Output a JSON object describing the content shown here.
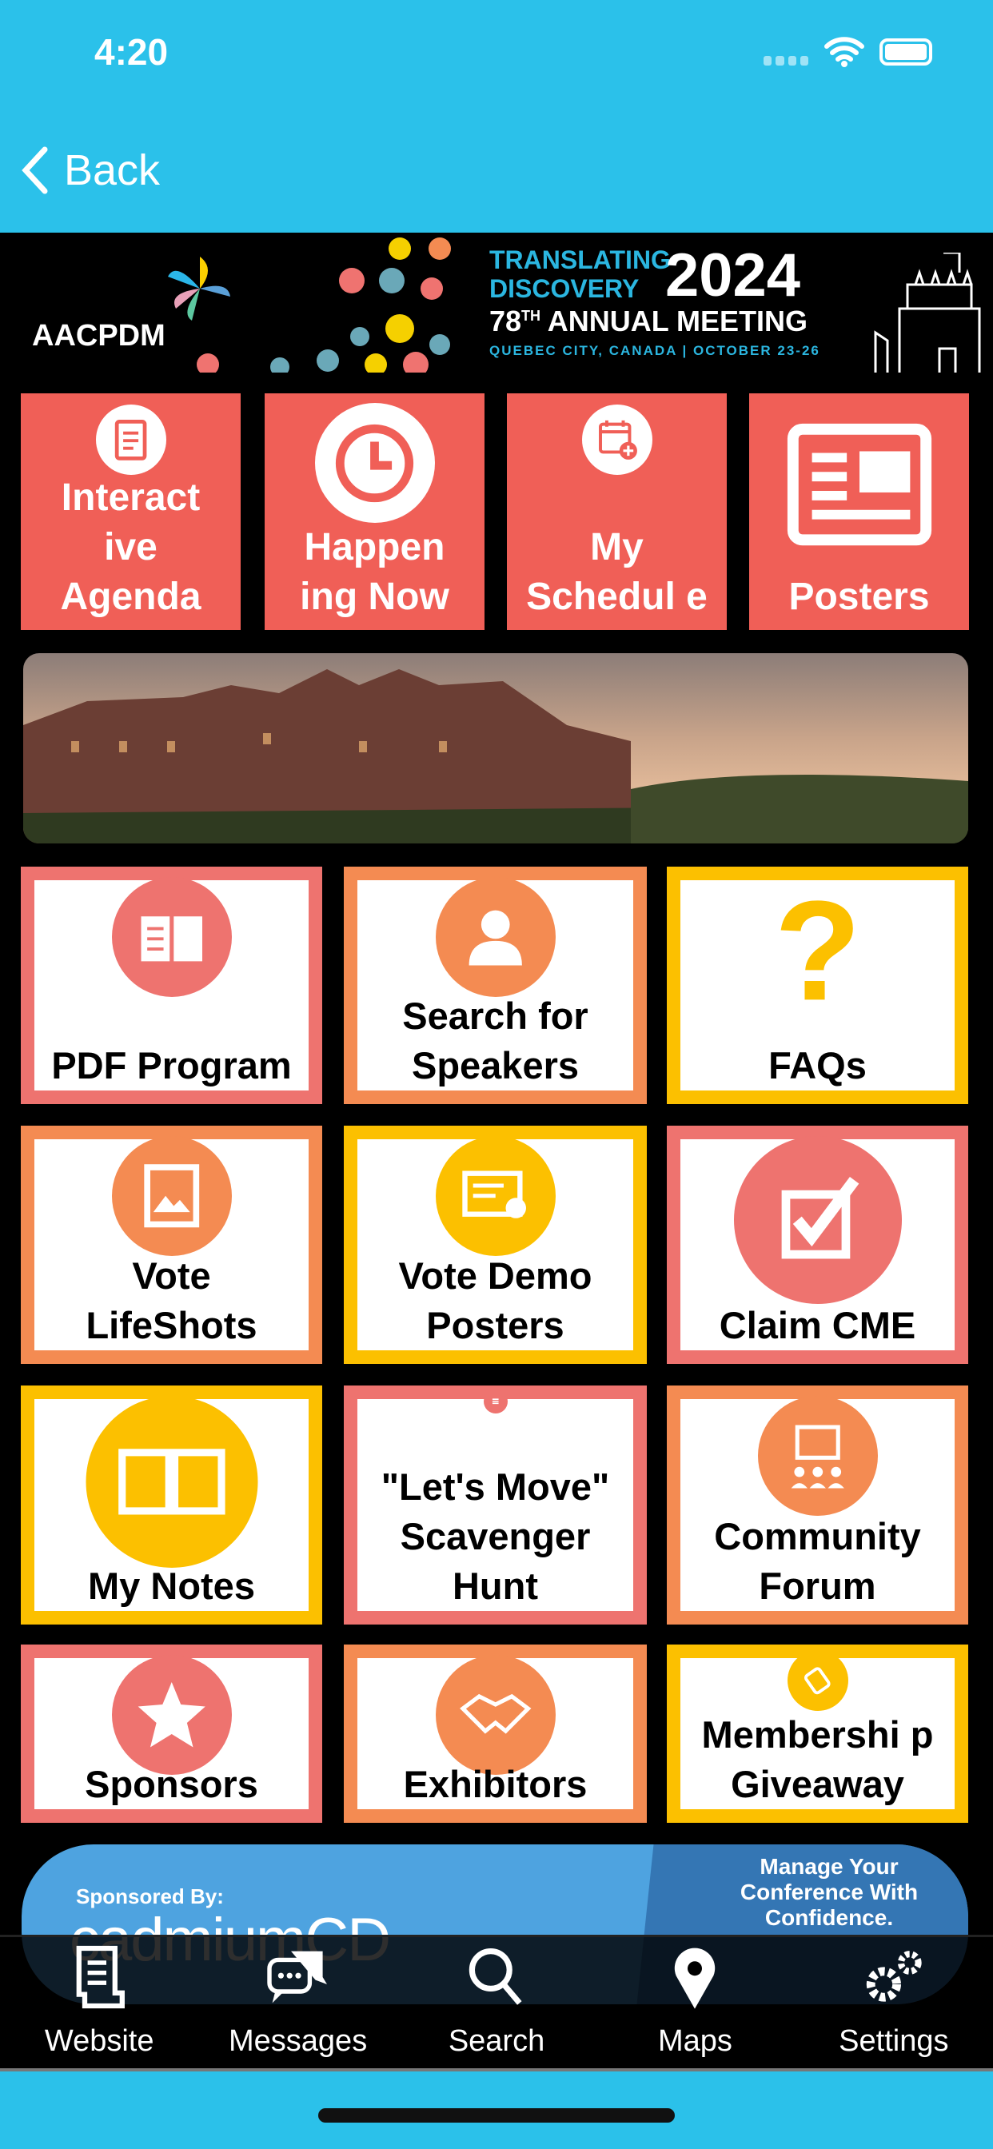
{
  "status": {
    "time": "4:20"
  },
  "nav": {
    "back_label": "Back"
  },
  "banner": {
    "org": "AACPDM",
    "line1": "TRANSLATING",
    "line2": "DISCOVERY",
    "year": "2024",
    "meeting_num": "78",
    "meeting_sup": "TH",
    "meeting": "ANNUAL MEETING",
    "location": "QUEBEC CITY, CANADA",
    "dates": "OCTOBER 23-26"
  },
  "top_tiles": [
    {
      "label": "Interact ive Agenda",
      "icon": "clipboard-icon"
    },
    {
      "label": "Happen ing Now",
      "icon": "clock-icon"
    },
    {
      "label": "My Schedul e",
      "icon": "calendar-add-icon"
    },
    {
      "label": "Posters",
      "icon": "newspaper-icon"
    }
  ],
  "grid": [
    {
      "label": "PDF Program",
      "icon": "book-icon",
      "color": "#ee736f"
    },
    {
      "label": "Search for Speakers",
      "icon": "person-icon",
      "color": "#f48b52"
    },
    {
      "label": "FAQs",
      "icon": "question-icon",
      "color": "#fcc000"
    },
    {
      "label": "Vote LifeShots",
      "icon": "image-icon",
      "color": "#f48b52"
    },
    {
      "label": "Vote Demo Posters",
      "icon": "certificate-icon",
      "color": "#fcc000"
    },
    {
      "label": "Claim CME",
      "icon": "checkbox-icon",
      "color": "#ee736f"
    },
    {
      "label": "My Notes",
      "icon": "open-book-icon",
      "color": "#fcc000"
    },
    {
      "label": "\"Let's Move\" Scavenger Hunt",
      "icon": "list-icon",
      "color": "#ee736f"
    },
    {
      "label": "Community Forum",
      "icon": "presentation-icon",
      "color": "#f48b52"
    },
    {
      "label": "Sponsors",
      "icon": "star-icon",
      "color": "#ee736f"
    },
    {
      "label": "Exhibitors",
      "icon": "handshake-icon",
      "color": "#f48b52"
    },
    {
      "label": "Membershi p Giveaway",
      "icon": "ticket-icon",
      "color": "#fcc000"
    }
  ],
  "sponsor": {
    "prefix": "Sponsored By:",
    "brand": "cadmiumCD",
    "tagline1": "Manage Your",
    "tagline2": "Conference With",
    "tagline3": "Confidence."
  },
  "tabs": [
    {
      "label": "Website",
      "icon": "document-icon"
    },
    {
      "label": "Messages",
      "icon": "chat-icon"
    },
    {
      "label": "Search",
      "icon": "search-icon"
    },
    {
      "label": "Maps",
      "icon": "map-pin-icon"
    },
    {
      "label": "Settings",
      "icon": "gears-icon"
    }
  ],
  "colors": {
    "header": "#2bc1ea",
    "tile": "#f05f57",
    "salmon": "#ee736f",
    "orange": "#f48b52",
    "yellow": "#fcc000"
  }
}
